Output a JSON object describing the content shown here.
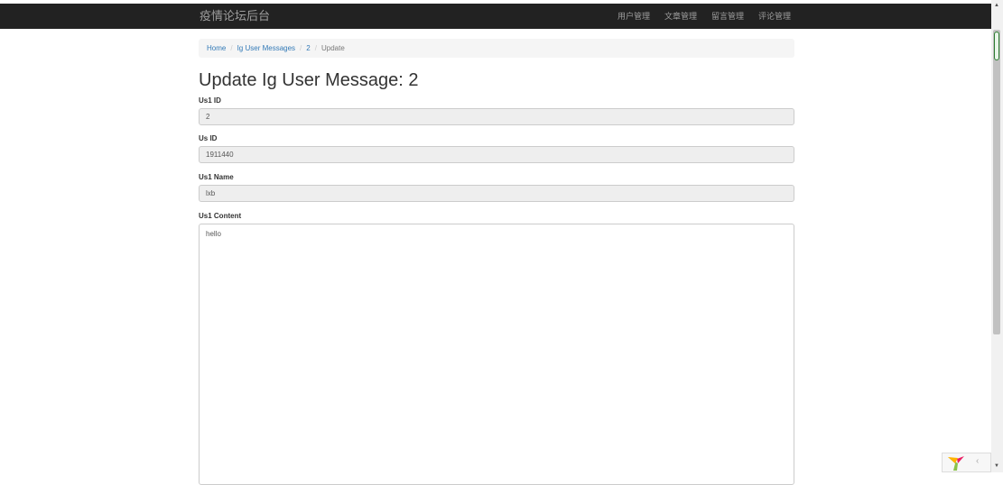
{
  "navbar": {
    "brand": "疫情论坛后台",
    "links": [
      "用户管理",
      "文章管理",
      "留言管理",
      "评论管理"
    ]
  },
  "breadcrumb": {
    "home": "Home",
    "messages": "Ig User Messages",
    "id": "2",
    "current": "Update",
    "separator": "/"
  },
  "page": {
    "title": "Update Ig User Message: 2"
  },
  "form": {
    "us1_id": {
      "label": "Us1 ID",
      "value": "2"
    },
    "us_id": {
      "label": "Us ID",
      "value": "1911440"
    },
    "us1_name": {
      "label": "Us1 Name",
      "value": "lxb"
    },
    "us1_content": {
      "label": "Us1 Content",
      "value": "hello"
    }
  },
  "scrollbar": {
    "up_arrow": "▲",
    "down_arrow": "▼"
  },
  "debug_toolbar": {
    "toggle": "‹"
  },
  "colors": {
    "navbar_bg": "#222222",
    "navbar_text": "#9d9d9d",
    "link": "#337ab7",
    "breadcrumb_bg": "#f5f5f5",
    "readonly_bg": "#eeeeee"
  }
}
